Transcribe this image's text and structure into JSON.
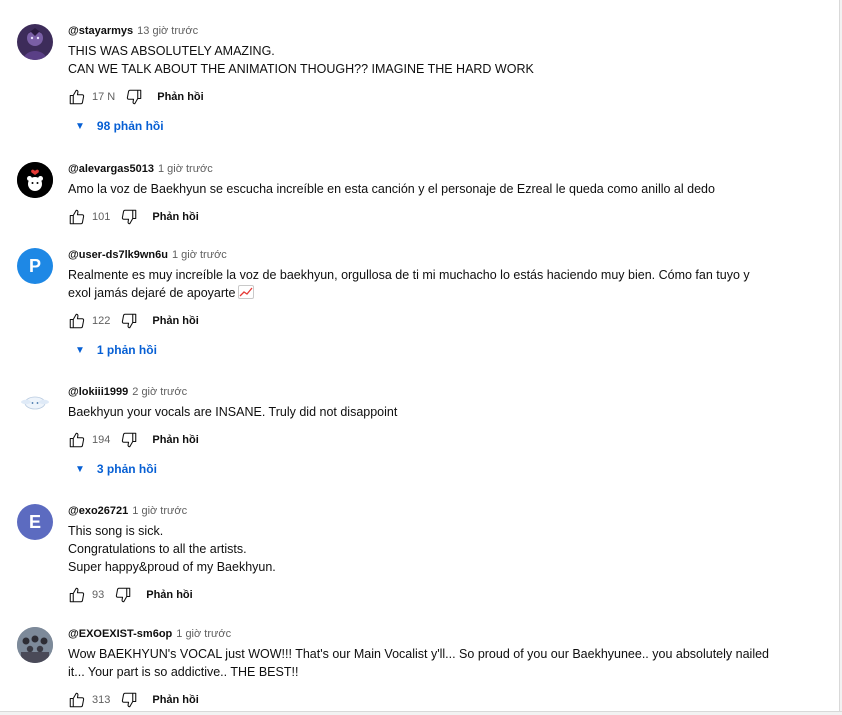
{
  "ui": {
    "reply_label": "Phản hồi"
  },
  "comments": [
    {
      "handle": "@stayarmys",
      "time": "13 giờ trước",
      "lines": [
        "THIS WAS ABSOLUTELY AMAZING.",
        "CAN WE TALK ABOUT THE ANIMATION THOUGH?? IMAGINE THE HARD WORK"
      ],
      "likes": "17 N",
      "replies": "98 phản hồi",
      "avatar": {
        "type": "image",
        "icon": "anime-character-avatar"
      }
    },
    {
      "handle": "@alevargas5013",
      "time": "1 giờ trước",
      "lines": [
        "Amo la voz de Baekhyun se escucha increíble en esta canción y el personaje de Ezreal le queda como anillo al dedo"
      ],
      "likes": "101",
      "avatar": {
        "type": "image",
        "icon": "bear-heart-avatar"
      }
    },
    {
      "handle": "@user-ds7lk9wn6u",
      "time": "1 giờ trước",
      "lines": [
        "Realmente es muy increíble la voz de baekhyun, orgullosa de ti mi muchacho lo estás haciendo muy bien. Cómo fan tuyo y",
        "exol jamás dejaré de apoyarte"
      ],
      "emoji": "chart-increasing-emoji",
      "likes": "122",
      "replies": "1 phản hồi",
      "avatar": {
        "type": "letter",
        "letter": "P",
        "color": "#1e88e5"
      }
    },
    {
      "handle": "@lokiii1999",
      "time": "2 giờ trước",
      "lines": [
        "Baekhyun your vocals are INSANE. Truly did not disappoint"
      ],
      "likes": "194",
      "replies": "3 phản hồi",
      "avatar": {
        "type": "image",
        "icon": "cinnamoroll-avatar"
      }
    },
    {
      "handle": "@exo26721",
      "time": "1 giờ trước",
      "lines": [
        "This song is sick.",
        "Congratulations to all the artists.",
        "Super happy&proud of my Baekhyun."
      ],
      "likes": "93",
      "avatar": {
        "type": "letter",
        "letter": "E",
        "color": "#5c6bc0"
      }
    },
    {
      "handle": "@EXOEXIST-sm6op",
      "time": "1 giờ trước",
      "lines": [
        "Wow BAEKHYUN's VOCAL just WOW!!! That's our Main Vocalist y'll... So proud of you our Baekhyunee.. you absolutely nailed",
        "it... Your part is so addictive.. THE BEST!!"
      ],
      "likes": "313",
      "avatar": {
        "type": "image",
        "icon": "group-photo-avatar"
      }
    }
  ]
}
